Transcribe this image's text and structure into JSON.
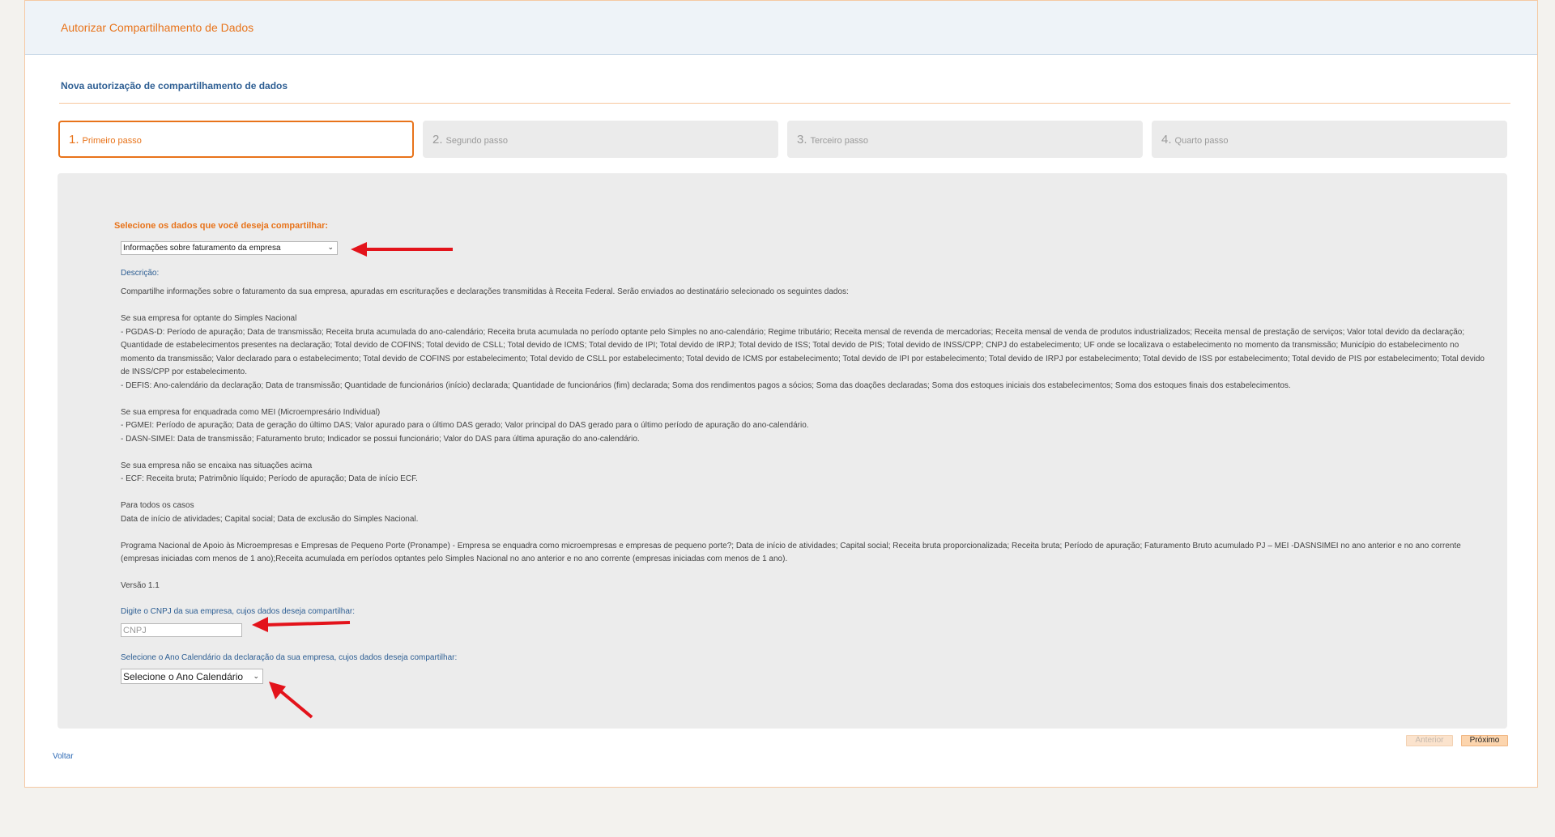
{
  "header": {
    "title": "Autorizar Compartilhamento de Dados"
  },
  "page": {
    "subtitle": "Nova autorização de compartilhamento de dados"
  },
  "steps": [
    {
      "num": "1.",
      "label": "Primeiro passo",
      "active": true
    },
    {
      "num": "2.",
      "label": "Segundo passo",
      "active": false
    },
    {
      "num": "3.",
      "label": "Terceiro passo",
      "active": false
    },
    {
      "num": "4.",
      "label": "Quarto passo",
      "active": false
    }
  ],
  "form": {
    "select_label": "Selecione os dados que você deseja compartilhar:",
    "selected_data": "Informações sobre faturamento da empresa",
    "description_label": "Descrição:",
    "description": {
      "intro": "Compartilhe informações sobre o faturamento da sua empresa, apuradas em escriturações e declarações transmitidas à Receita Federal. Serão enviados ao destinatário selecionado os seguintes dados:",
      "simples_title": "Se sua empresa for optante do Simples Nacional",
      "simples_pgdas": "- PGDAS-D: Período de apuração; Data de transmissão; Receita bruta acumulada do ano-calendário; Receita bruta acumulada no período optante pelo Simples no ano-calendário; Regime tributário; Receita mensal de revenda de mercadorias; Receita mensal de venda de produtos industrializados; Receita mensal de prestação de serviços; Valor total devido da declaração; Quantidade de estabelecimentos presentes na declaração; Total devido de COFINS; Total devido de CSLL; Total devido de ICMS; Total devido de IPI; Total devido de IRPJ; Total devido de ISS; Total devido de PIS; Total devido de INSS/CPP; CNPJ do estabelecimento; UF onde se localizava o estabelecimento no momento da transmissão; Município do estabelecimento no momento da transmissão; Valor declarado para o estabelecimento; Total devido de COFINS por estabelecimento; Total devido de CSLL por estabelecimento; Total devido de ICMS por estabelecimento; Total devido de IPI por estabelecimento; Total devido de IRPJ por estabelecimento; Total devido de ISS por estabelecimento; Total devido de PIS por estabelecimento; Total devido de INSS/CPP por estabelecimento.",
      "simples_defis": "- DEFIS: Ano-calendário da declaração; Data de transmissão; Quantidade de funcionários (início) declarada; Quantidade de funcionários (fim) declarada; Soma dos rendimentos pagos a sócios; Soma das doações declaradas; Soma dos estoques iniciais dos estabelecimentos; Soma dos estoques finais dos estabelecimentos.",
      "mei_title": "Se sua empresa for enquadrada como MEI (Microempresário Individual)",
      "mei_pgmei": "- PGMEI: Período de apuração; Data de geração do último DAS; Valor apurado para o último DAS gerado; Valor principal do DAS gerado para o último período de apuração do ano-calendário.",
      "mei_dasn": "- DASN-SIMEI: Data de transmissão; Faturamento bruto; Indicador se possui funcionário; Valor do DAS para última apuração do ano-calendário.",
      "other_title": "Se sua empresa não se encaixa nas situações acima",
      "other_ecf": "- ECF: Receita bruta; Patrimônio líquido; Período de apuração; Data de início ECF.",
      "all_title": "Para todos os casos",
      "all_text": "Data de início de atividades; Capital social; Data de exclusão do Simples Nacional.",
      "pronampe": "Programa Nacional de Apoio às Microempresas e Empresas de Pequeno Porte (Pronampe) - Empresa se enquadra como microempresas e empresas de pequeno porte?; Data de início de atividades; Capital social; Receita bruta proporcionalizada; Receita bruta; Período de apuração; Faturamento Bruto acumulado PJ – MEI -DASNSIMEI no ano anterior e no ano corrente (empresas iniciadas com menos de 1 ano);Receita acumulada em períodos optantes pelo Simples Nacional no ano anterior e no ano corrente (empresas iniciadas com menos de 1 ano).",
      "version": "Versão 1.1"
    },
    "cnpj_label": "Digite o CNPJ da sua empresa, cujos dados deseja compartilhar:",
    "cnpj_placeholder": "CNPJ",
    "cnpj_value": "",
    "year_label": "Selecione o Ano Calendário da declaração da sua empresa, cujos dados deseja compartilhar:",
    "year_selected": "Selecione o Ano Calendário"
  },
  "buttons": {
    "previous": "Anterior",
    "next": "Próximo"
  },
  "footer": {
    "back_link": "Voltar"
  },
  "icons": {
    "dropdown": "chevron-down-icon",
    "annotation": "red-arrow-icon"
  },
  "colors": {
    "accent": "#e8731a",
    "link_blue": "#2d5e93",
    "annotation_red": "#e3131b"
  }
}
